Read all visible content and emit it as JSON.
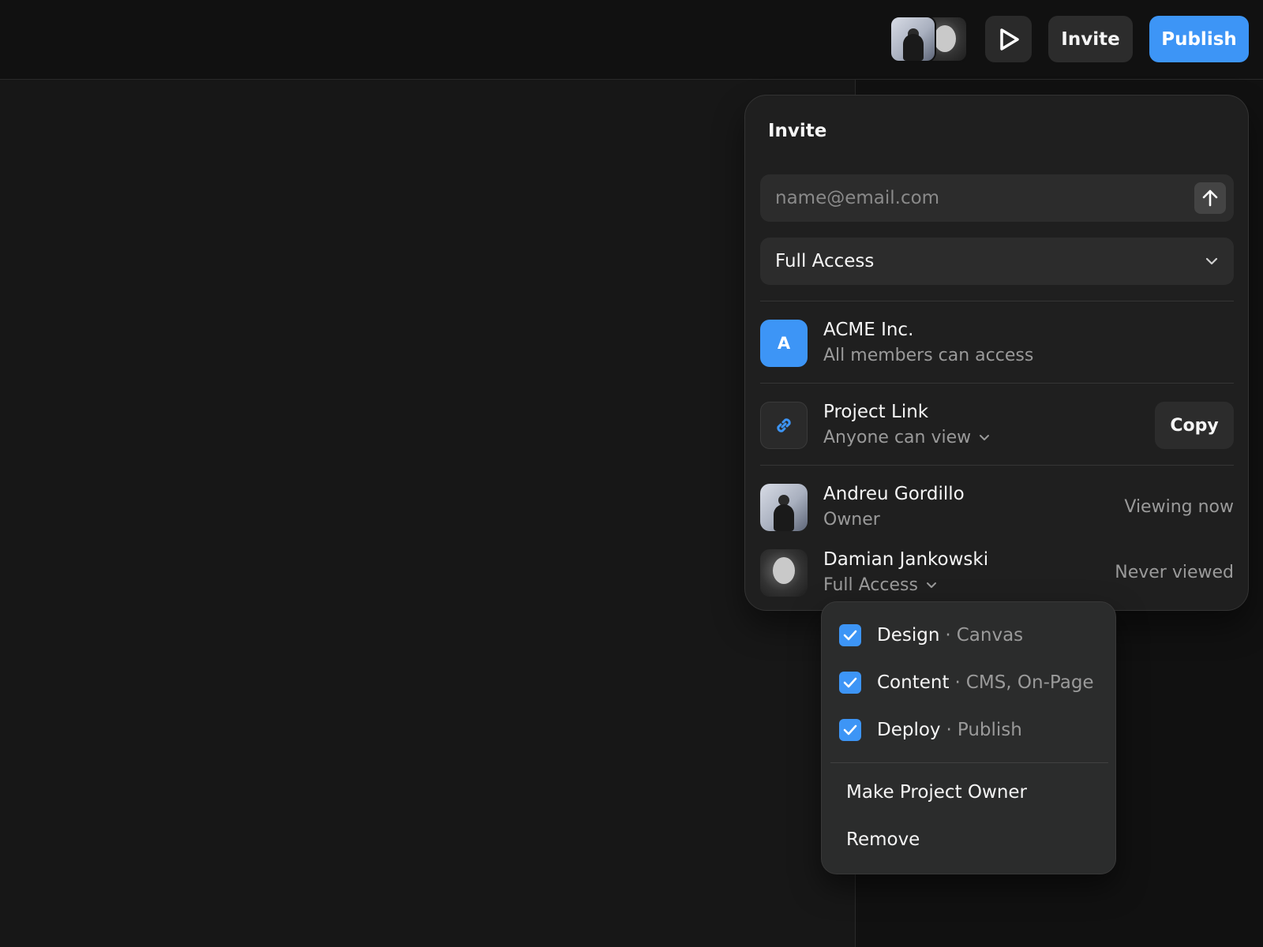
{
  "toolbar": {
    "collaborators": [
      {
        "name": "Andreu Gordillo",
        "avatar": "photo-light"
      },
      {
        "name": "Damian Jankowski",
        "avatar": "photo-dark"
      }
    ],
    "preview_icon": "play-icon",
    "invite_label": "Invite",
    "publish_label": "Publish"
  },
  "invite_panel": {
    "title": "Invite",
    "email_placeholder": "name@email.com",
    "submit_icon": "arrow-up-icon",
    "access_value": "Full Access",
    "organization": {
      "initial": "A",
      "name": "ACME Inc.",
      "subtitle": "All members can access"
    },
    "project_link": {
      "icon": "link-icon",
      "title": "Project Link",
      "permission": "Anyone can view",
      "copy_label": "Copy"
    },
    "members": [
      {
        "name": "Andreu Gordillo",
        "role": "Owner",
        "status": "Viewing now",
        "avatar": "photo-light"
      },
      {
        "name": "Damian Jankowski",
        "role": "Full Access",
        "status": "Never viewed",
        "avatar": "photo-dark"
      }
    ]
  },
  "permission_menu": {
    "options": [
      {
        "label": "Design",
        "detail": "Canvas",
        "checked": true
      },
      {
        "label": "Content",
        "detail": "CMS, On-Page",
        "checked": true
      },
      {
        "label": "Deploy",
        "detail": "Publish",
        "checked": true
      }
    ],
    "separator": "·",
    "actions": [
      "Make Project Owner",
      "Remove"
    ]
  },
  "colors": {
    "accent": "#3d95f6",
    "background": "#151515",
    "panel": "#1f1f1f"
  }
}
